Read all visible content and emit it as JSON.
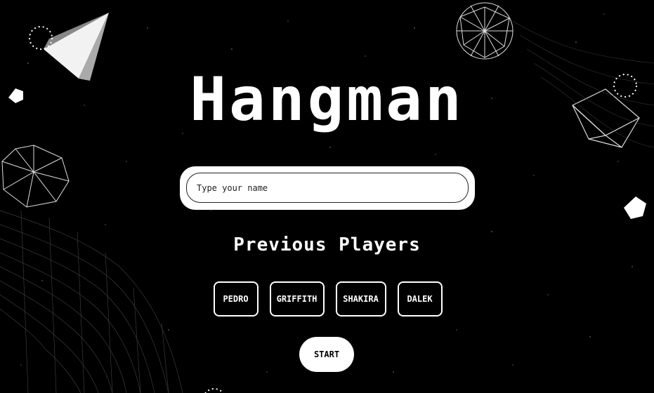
{
  "title": "Hangman",
  "name_input": {
    "placeholder": "Type your name",
    "value": ""
  },
  "previous_players": {
    "heading": "Previous Players",
    "players": [
      "PEDRO",
      "GRIFFITH",
      "SHAKIRA",
      "DALEK"
    ]
  },
  "start_label": "START",
  "colors": {
    "background": "#000000",
    "foreground": "#ffffff"
  }
}
